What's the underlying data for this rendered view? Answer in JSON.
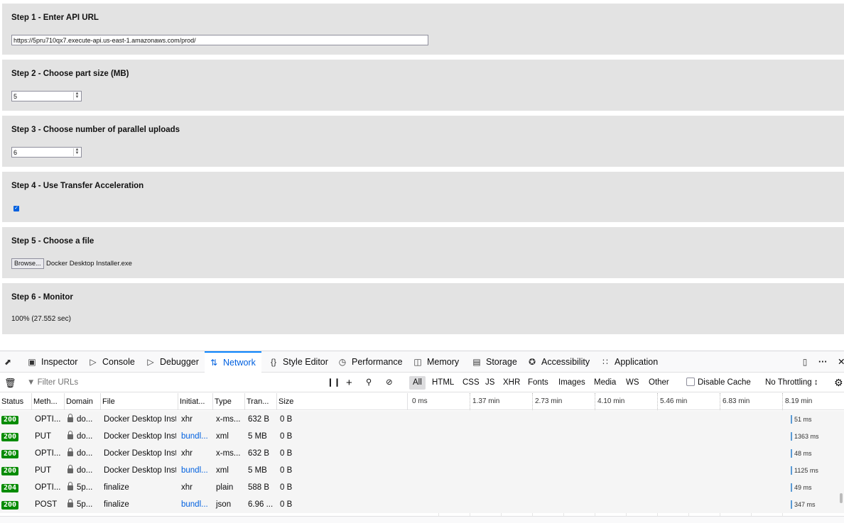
{
  "steps": {
    "s1": {
      "title": "Step 1 - Enter API URL",
      "value": "https://5pru710qx7.execute-api.us-east-1.amazonaws.com/prod/"
    },
    "s2": {
      "title": "Step 2 - Choose part size (MB)",
      "value": "5"
    },
    "s3": {
      "title": "Step 3 - Choose number of parallel uploads",
      "value": "6"
    },
    "s4": {
      "title": "Step 4 - Use Transfer Acceleration",
      "checked": true
    },
    "s5": {
      "title": "Step 5 - Choose a file",
      "browse_label": "Browse...",
      "file_name": "Docker Desktop Installer.exe"
    },
    "s6": {
      "title": "Step 6 - Monitor",
      "progress": "100% (27.552 sec)"
    }
  },
  "devtools": {
    "tabs": {
      "inspector": "Inspector",
      "console": "Console",
      "debugger": "Debugger",
      "network": "Network",
      "style_editor": "Style Editor",
      "performance": "Performance",
      "memory": "Memory",
      "storage": "Storage",
      "accessibility": "Accessibility",
      "application": "Application"
    },
    "active_tab": "Network",
    "toolbar": {
      "filter_placeholder": "Filter URLs",
      "types": {
        "all": "All",
        "html": "HTML",
        "css": "CSS",
        "js": "JS",
        "xhr": "XHR",
        "fonts": "Fonts",
        "images": "Images",
        "media": "Media",
        "ws": "WS",
        "other": "Other"
      },
      "disable_cache": "Disable Cache",
      "throttling": "No Throttling ↕"
    },
    "columns": {
      "status": "Status",
      "method": "Meth...",
      "domain": "Domain",
      "file": "File",
      "initiator": "Initiat...",
      "type": "Type",
      "transferred": "Tran...",
      "size": "Size"
    },
    "timeline_ticks": [
      "0 ms",
      "1.37 min",
      "2.73 min",
      "4.10 min",
      "5.46 min",
      "6.83 min",
      "8.19 min"
    ],
    "requests": [
      {
        "status": "200",
        "method": "OPTI...",
        "domain": "do...",
        "file": "Docker Desktop Inst",
        "initiator": "xhr",
        "type": "x-ms...",
        "transferred": "632 B",
        "size": "0 B",
        "timing": "51 ms"
      },
      {
        "status": "200",
        "method": "PUT",
        "domain": "do...",
        "file": "Docker Desktop Inst",
        "initiator": "bundl...",
        "type": "xml",
        "transferred": "5 MB",
        "size": "0 B",
        "timing": "1363 ms"
      },
      {
        "status": "200",
        "method": "OPTI...",
        "domain": "do...",
        "file": "Docker Desktop Inst",
        "initiator": "xhr",
        "type": "x-ms...",
        "transferred": "632 B",
        "size": "0 B",
        "timing": "48 ms"
      },
      {
        "status": "200",
        "method": "PUT",
        "domain": "do...",
        "file": "Docker Desktop Inst",
        "initiator": "bundl...",
        "type": "xml",
        "transferred": "5 MB",
        "size": "0 B",
        "timing": "1125 ms"
      },
      {
        "status": "204",
        "method": "OPTI...",
        "domain": "5p...",
        "file": "finalize",
        "initiator": "xhr",
        "type": "plain",
        "transferred": "588 B",
        "size": "0 B",
        "timing": "49 ms"
      },
      {
        "status": "200",
        "method": "POST",
        "domain": "5p...",
        "file": "finalize",
        "initiator": "bundl...",
        "type": "json",
        "transferred": "6.96 ...",
        "size": "0 B",
        "timing": "347 ms"
      }
    ]
  }
}
